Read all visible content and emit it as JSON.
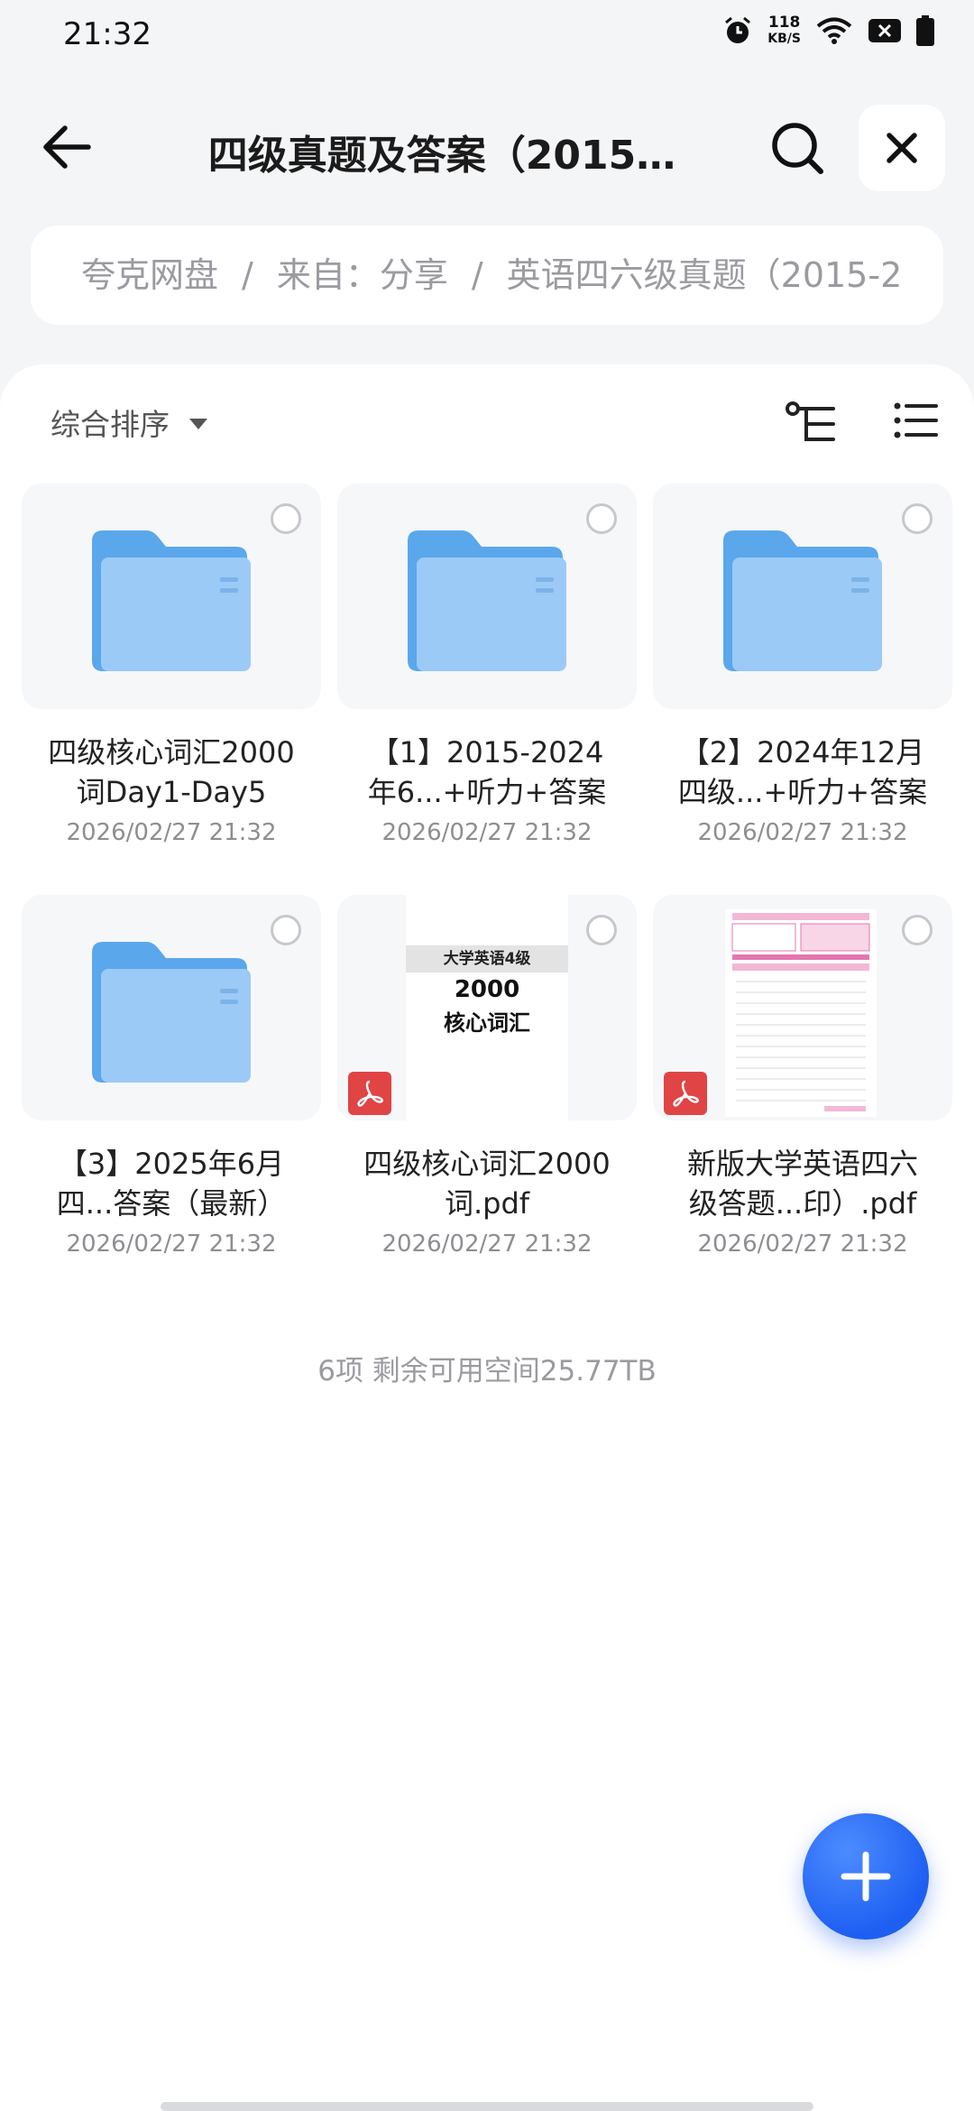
{
  "status_bar": {
    "time": "21:32",
    "net_speed_value": "118",
    "net_speed_unit": "KB/S",
    "icons": [
      "alarm-icon",
      "wifi-icon",
      "sim-icon",
      "battery-icon"
    ]
  },
  "app_bar": {
    "title": "四级真题及答案（2015…",
    "icons": [
      "back-arrow-icon",
      "search-icon",
      "close-icon"
    ]
  },
  "breadcrumb": {
    "items": [
      "夸克网盘",
      "来自：分享",
      "英语四六级真题（2015-2"
    ],
    "separator": "/"
  },
  "toolbar": {
    "sort_label": "综合排序",
    "icons": [
      "tree-view-icon",
      "list-view-icon"
    ]
  },
  "files": [
    {
      "name_line1": "四级核心词汇2000",
      "name_line2": "词Day1-Day5",
      "date": "2026/02/27 21:32",
      "type": "folder"
    },
    {
      "name_line1": "【1】2015-2024",
      "name_line2": "年6...+听力+答案",
      "date": "2026/02/27 21:32",
      "type": "folder"
    },
    {
      "name_line1": "【2】2024年12月",
      "name_line2": "四级...+听力+答案",
      "date": "2026/02/27 21:32",
      "type": "folder"
    },
    {
      "name_line1": "【3】2025年6月",
      "name_line2": "四...答案（最新）",
      "date": "2026/02/27 21:32",
      "type": "folder"
    },
    {
      "name_line1": "四级核心词汇2000",
      "name_line2": "词.pdf",
      "date": "2026/02/27 21:32",
      "type": "pdf",
      "cover": {
        "header": "大学英语4级",
        "number": "2000",
        "words": "核心词汇"
      }
    },
    {
      "name_line1": "新版大学英语四六",
      "name_line2": "级答题...印）.pdf",
      "date": "2026/02/27 21:32",
      "type": "pdf"
    }
  ],
  "footer": {
    "summary": "6项 剩余可用空间25.77TB"
  },
  "fab": {
    "icon": "plus-icon"
  },
  "colors": {
    "accent": "#1e5ff2",
    "folder": "#7cb8f2",
    "pdf": "#e04445",
    "muted": "#9a9ba0"
  }
}
